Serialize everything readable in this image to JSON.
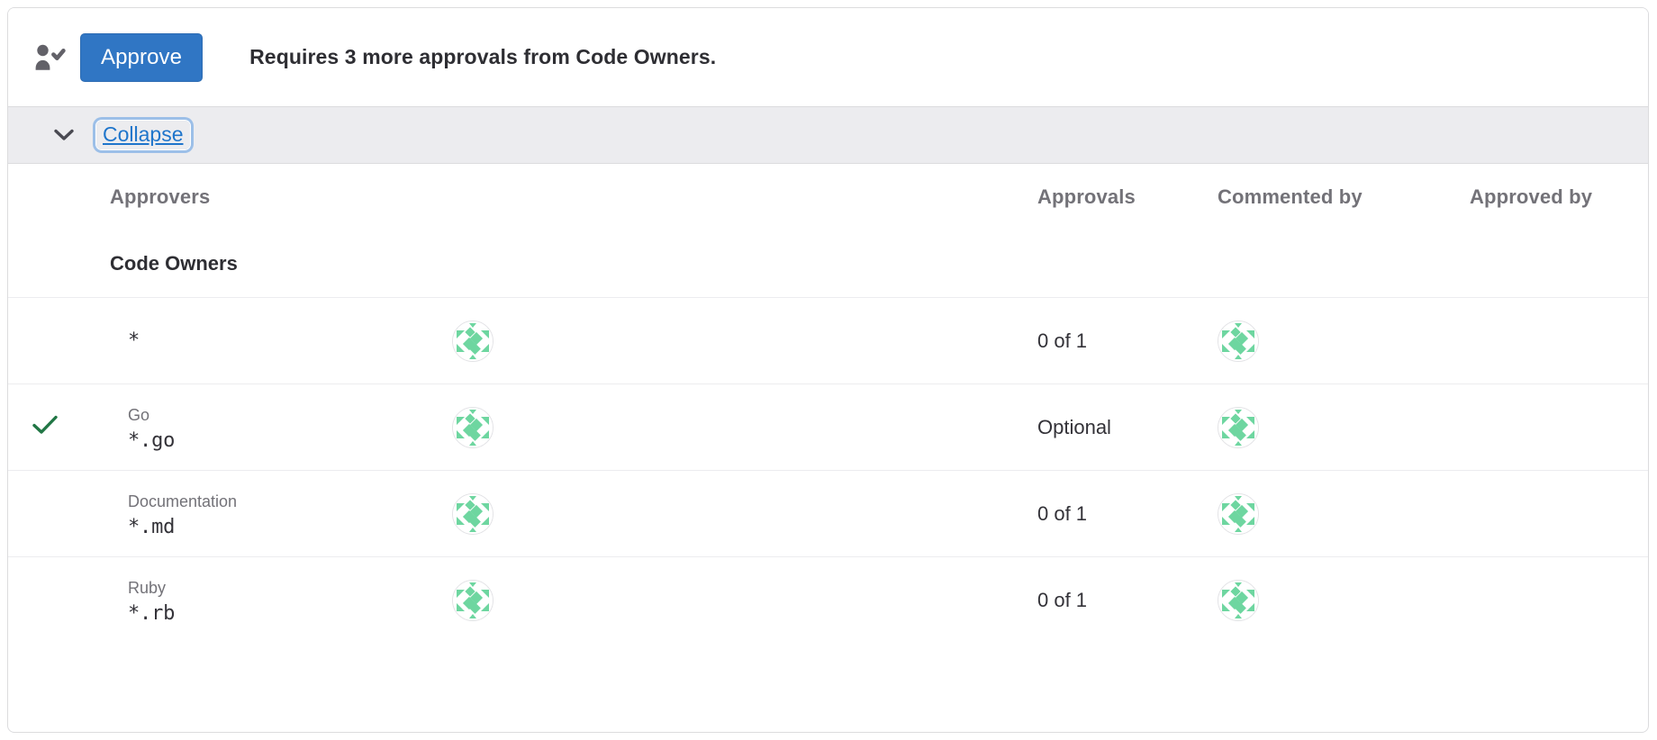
{
  "action_bar": {
    "icon": "user-check-icon",
    "approve_label": "Approve",
    "status_text": "Requires 3 more approvals from Code Owners."
  },
  "collapse_row": {
    "chevron_icon": "chevron-down-icon",
    "collapse_label": "Collapse"
  },
  "table": {
    "headers": {
      "check": "",
      "approvers": "Approvers",
      "avatars": "",
      "approvals": "Approvals",
      "commented_by": "Commented by",
      "approved_by": "Approved by"
    },
    "section_title": "Code Owners",
    "rows": [
      {
        "approved": false,
        "check_icon": "",
        "section": "",
        "pattern": "*",
        "avatar_icon": "identicon-avatar",
        "approvals": "0 of 1",
        "commented_by_avatar": "identicon-avatar",
        "approved_by": ""
      },
      {
        "approved": true,
        "check_icon": "check-icon",
        "section": "Go",
        "pattern": "*.go",
        "avatar_icon": "identicon-avatar",
        "approvals": "Optional",
        "commented_by_avatar": "identicon-avatar",
        "approved_by": ""
      },
      {
        "approved": false,
        "check_icon": "",
        "section": "Documentation",
        "pattern": "*.md",
        "avatar_icon": "identicon-avatar",
        "approvals": "0 of 1",
        "commented_by_avatar": "identicon-avatar",
        "approved_by": ""
      },
      {
        "approved": false,
        "check_icon": "",
        "section": "Ruby",
        "pattern": "*.rb",
        "avatar_icon": "identicon-avatar",
        "approvals": "0 of 1",
        "commented_by_avatar": "identicon-avatar",
        "approved_by": ""
      }
    ]
  },
  "colors": {
    "approve_button_bg": "#3076c4",
    "link_blue": "#1f75cb",
    "check_green": "#217645",
    "identicon_green": "#6ed6a0",
    "header_gray": "#737278",
    "strip_gray": "#ececef"
  }
}
